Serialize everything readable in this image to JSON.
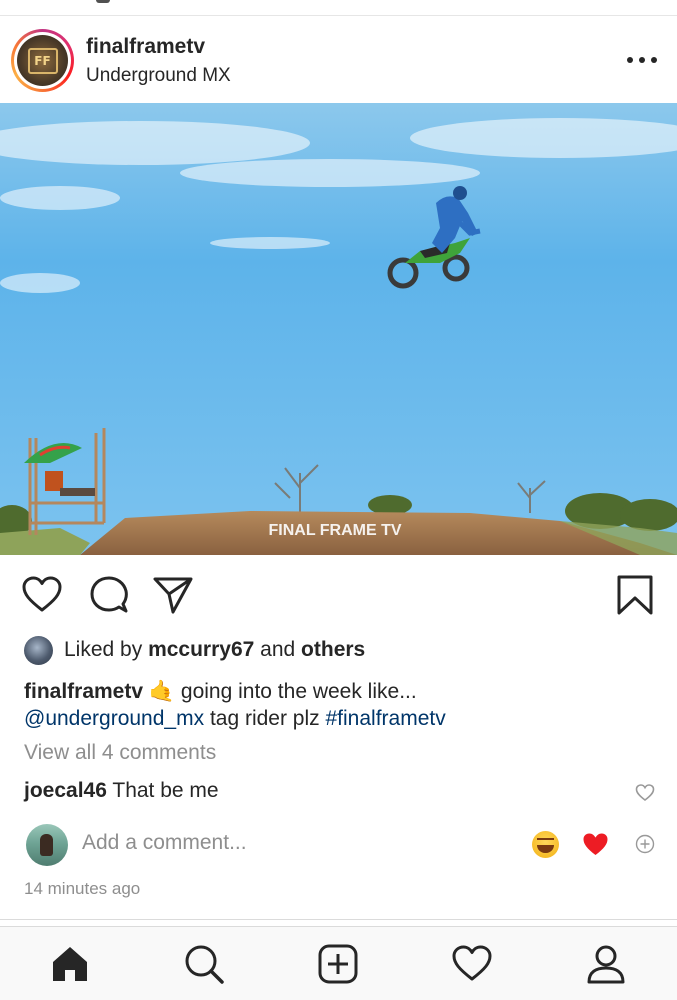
{
  "post": {
    "username": "finalframetv",
    "location": "Underground MX",
    "avatar_logo": "FF",
    "more_icon": "more-horizontal-icon",
    "image_watermark": "FINAL FRAME TV"
  },
  "actions": {
    "like_icon": "heart-icon",
    "comment_icon": "comment-icon",
    "share_icon": "paper-plane-icon",
    "save_icon": "bookmark-icon"
  },
  "likes": {
    "prefix": "Liked by",
    "user": "mccurry67",
    "and": "and",
    "others": "others"
  },
  "caption": {
    "username": "finalframetv",
    "emoji": "🤙",
    "text": "going into the week like...",
    "mention": "@underground_mx",
    "middle": "tag rider plz",
    "hashtag": "#finalframetv"
  },
  "comments": {
    "view_all": "View all 4 comments",
    "items": [
      {
        "username": "joecal46",
        "text": "That be me"
      }
    ]
  },
  "add_comment": {
    "placeholder": "Add a comment..."
  },
  "timestamp": "14 minutes ago",
  "colors": {
    "text": "#262626",
    "muted": "#8e8e8e",
    "link": "#003569",
    "sky": "#5db3ea",
    "dirt": "#a87a4e",
    "heart": "#ed1c24"
  }
}
